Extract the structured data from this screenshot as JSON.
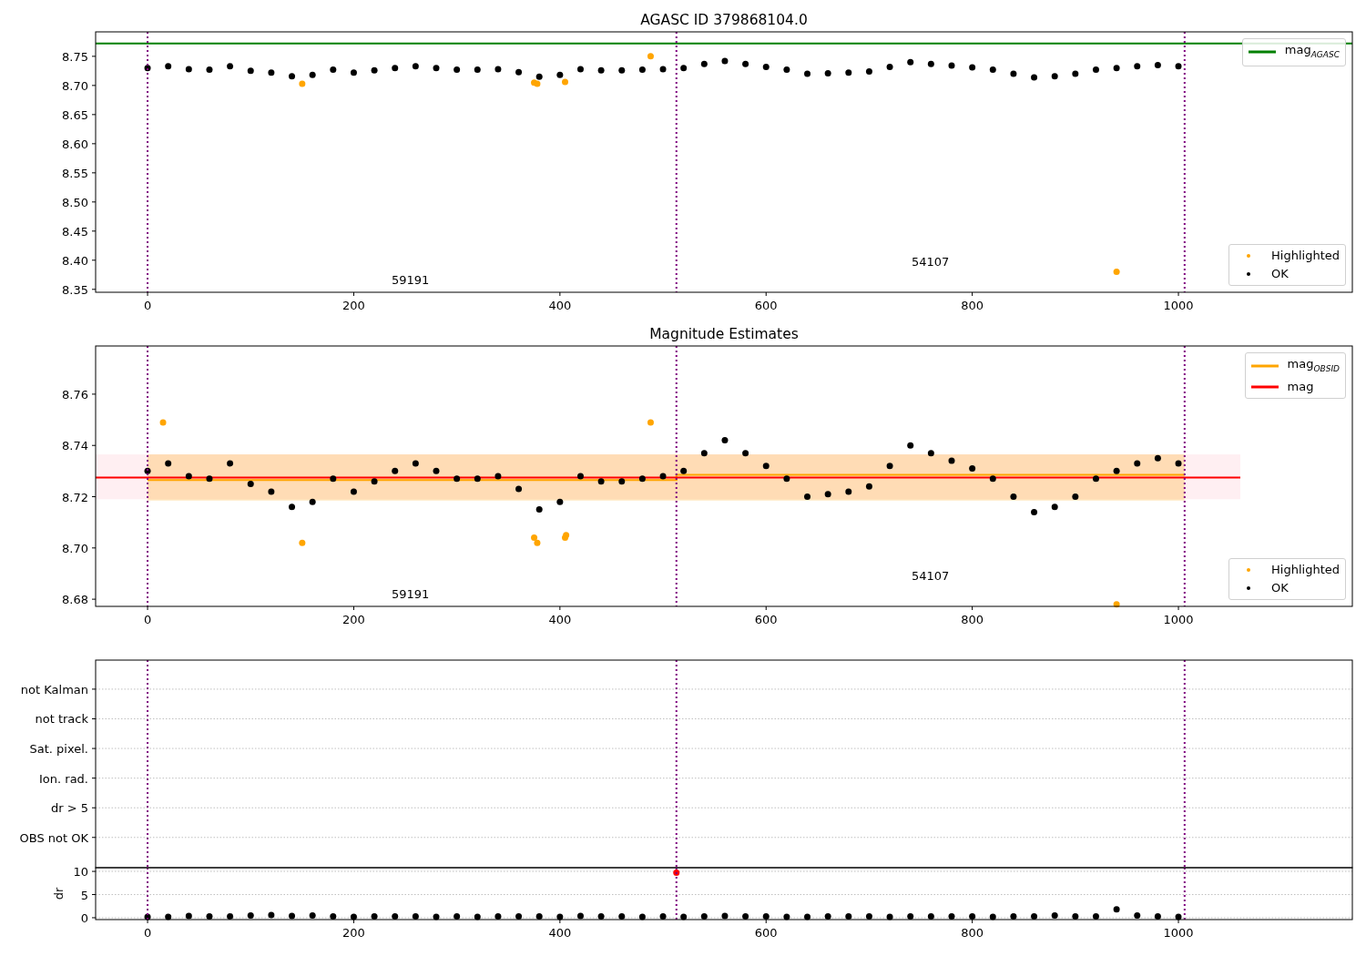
{
  "panels": [
    {
      "legend": true,
      "chart_data": {
        "type": "scatter",
        "title": "AGASC ID 379868104.0",
        "xlim": [
          -50.4,
          1168.7
        ],
        "ylim": [
          8.345,
          8.792
        ],
        "xticks": [
          0,
          200,
          400,
          600,
          800,
          1000
        ],
        "yticks": [
          {
            "value": 8.35,
            "label": "8.35"
          },
          {
            "value": 8.4,
            "label": "8.40"
          },
          {
            "value": 8.45,
            "label": "8.45"
          },
          {
            "value": 8.5,
            "label": "8.50"
          },
          {
            "value": 8.55,
            "label": "8.55"
          },
          {
            "value": 8.6,
            "label": "8.60"
          },
          {
            "value": 8.65,
            "label": "8.65"
          },
          {
            "value": 8.7,
            "label": "8.70"
          },
          {
            "value": 8.75,
            "label": "8.75"
          }
        ],
        "series": [
          {
            "name": "mag$_{AGASC}$",
            "type": "line",
            "color": "#008000",
            "x": [
              -50.4,
              1168.7
            ],
            "values": [
              8.772,
              8.772
            ]
          },
          {
            "name": "Highlighted",
            "color": "#ffa500",
            "x": [
              150,
              375,
              378,
              405,
              488,
              940
            ],
            "values": [
              8.703,
              8.705,
              8.703,
              8.706,
              8.75,
              8.38
            ]
          },
          {
            "name": "OK",
            "color": "#000000",
            "x": [
              0,
              20,
              40,
              60,
              80,
              100,
              120,
              140,
              160,
              180,
              200,
              220,
              240,
              260,
              280,
              300,
              320,
              340,
              360,
              380,
              400,
              420,
              440,
              460,
              480,
              500,
              520,
              540,
              560,
              580,
              600,
              620,
              640,
              660,
              680,
              700,
              720,
              740,
              760,
              780,
              800,
              820,
              840,
              860,
              880,
              900,
              920,
              940,
              960,
              980,
              1000
            ],
            "values": [
              8.73,
              8.733,
              8.728,
              8.727,
              8.733,
              8.725,
              8.722,
              8.716,
              8.718,
              8.727,
              8.722,
              8.726,
              8.73,
              8.733,
              8.73,
              8.727,
              8.727,
              8.728,
              8.723,
              8.715,
              8.718,
              8.728,
              8.726,
              8.726,
              8.727,
              8.728,
              8.73,
              8.737,
              8.742,
              8.737,
              8.732,
              8.727,
              8.72,
              8.721,
              8.722,
              8.724,
              8.732,
              8.74,
              8.737,
              8.734,
              8.731,
              8.727,
              8.72,
              8.714,
              8.716,
              8.72,
              8.727,
              8.73,
              8.733,
              8.735,
              8.733
            ]
          }
        ],
        "ref_lines": [
          {
            "axis": "x",
            "value": 0,
            "color": "#800080"
          },
          {
            "axis": "x",
            "value": 513,
            "color": "#800080"
          },
          {
            "axis": "x",
            "value": 1006,
            "color": "#800080"
          }
        ],
        "annotations": [
          "59191",
          "54107"
        ]
      }
    },
    {
      "legend": true,
      "chart_data": {
        "type": "scatter",
        "title": "Magnitude Estimates",
        "xlim": [
          -50.4,
          1168.7
        ],
        "ylim": [
          8.6772,
          8.7788
        ],
        "xticks": [
          0,
          200,
          400,
          600,
          800,
          1000
        ],
        "yticks": [
          {
            "value": 8.68,
            "label": "8.68"
          },
          {
            "value": 8.7,
            "label": "8.70"
          },
          {
            "value": 8.72,
            "label": "8.72"
          },
          {
            "value": 8.74,
            "label": "8.74"
          },
          {
            "value": 8.76,
            "label": "8.76"
          }
        ],
        "series": [
          {
            "name": "mag$_{OBSID}$",
            "type": "line",
            "color": "#ffa500",
            "x": [
              0,
              513,
              513,
              1006
            ],
            "values": [
              8.7265,
              8.7265,
              8.7285,
              8.7285
            ]
          },
          {
            "name": "mag",
            "type": "line",
            "color": "#ff0000",
            "x": [
              -50.4,
              1060
            ],
            "values": [
              8.7275,
              8.7275
            ]
          },
          {
            "name": "Highlighted",
            "color": "#ffa500",
            "x": [
              15,
              150,
              375,
              378,
              405,
              406,
              488,
              940
            ],
            "values": [
              8.749,
              8.702,
              8.704,
              8.702,
              8.704,
              8.705,
              8.749,
              8.678
            ]
          },
          {
            "name": "OK",
            "color": "#000000",
            "x": [
              0,
              20,
              40,
              60,
              80,
              100,
              120,
              140,
              160,
              180,
              200,
              220,
              240,
              260,
              280,
              300,
              320,
              340,
              360,
              380,
              400,
              420,
              440,
              460,
              480,
              500,
              520,
              540,
              560,
              580,
              600,
              620,
              640,
              660,
              680,
              700,
              720,
              740,
              760,
              780,
              800,
              820,
              840,
              860,
              880,
              900,
              920,
              940,
              960,
              980,
              1000
            ],
            "values": [
              8.73,
              8.733,
              8.728,
              8.727,
              8.733,
              8.725,
              8.722,
              8.716,
              8.718,
              8.727,
              8.722,
              8.726,
              8.73,
              8.733,
              8.73,
              8.727,
              8.727,
              8.728,
              8.723,
              8.715,
              8.718,
              8.728,
              8.726,
              8.726,
              8.727,
              8.728,
              8.73,
              8.737,
              8.742,
              8.737,
              8.732,
              8.727,
              8.72,
              8.721,
              8.722,
              8.724,
              8.732,
              8.74,
              8.737,
              8.734,
              8.731,
              8.727,
              8.72,
              8.714,
              8.716,
              8.72,
              8.727,
              8.73,
              8.733,
              8.735,
              8.733
            ]
          }
        ],
        "bands": [
          {
            "axis": "y",
            "from": 8.719,
            "to": 8.7365,
            "color": "#ffc0cb"
          },
          {
            "axis": "y",
            "from": 8.7185,
            "to": 8.7365,
            "color": "#ffa500"
          }
        ],
        "ref_lines": [
          {
            "axis": "x",
            "value": 0,
            "color": "#800080"
          },
          {
            "axis": "x",
            "value": 513,
            "color": "#800080"
          },
          {
            "axis": "x",
            "value": 1006,
            "color": "#800080"
          }
        ],
        "annotations": [
          "59191",
          "54107"
        ]
      }
    },
    {
      "chart_data": {
        "type": "other",
        "categories": [
          "not Kalman",
          "not track",
          "Sat. pixel.",
          "Ion. rad.",
          "dr > 5",
          "OBS not OK"
        ]
      }
    },
    {
      "chart_data": {
        "type": "scatter",
        "ylabel": "dr",
        "xlim": [
          -50.4,
          1168.7
        ],
        "ylim": [
          -0.4,
          10.8
        ],
        "xticks": [
          0,
          200,
          400,
          600,
          800,
          1000
        ],
        "yticks": [
          0,
          5,
          10
        ],
        "series": [
          {
            "color": "#000000",
            "x": [
              0,
              20,
              40,
              60,
              80,
              100,
              120,
              140,
              160,
              180,
              200,
              220,
              240,
              260,
              280,
              300,
              320,
              340,
              360,
              380,
              400,
              420,
              440,
              460,
              480,
              500,
              520,
              540,
              560,
              580,
              600,
              620,
              640,
              660,
              680,
              700,
              720,
              740,
              760,
              780,
              800,
              820,
              840,
              860,
              880,
              900,
              920,
              940,
              960,
              980,
              1000
            ],
            "values": [
              0.2,
              0.2,
              0.4,
              0.3,
              0.3,
              0.5,
              0.6,
              0.4,
              0.5,
              0.3,
              0.2,
              0.3,
              0.3,
              0.3,
              0.2,
              0.3,
              0.2,
              0.3,
              0.3,
              0.3,
              0.2,
              0.4,
              0.3,
              0.3,
              0.2,
              0.3,
              0.2,
              0.3,
              0.4,
              0.3,
              0.3,
              0.2,
              0.2,
              0.3,
              0.3,
              0.3,
              0.2,
              0.3,
              0.3,
              0.3,
              0.3,
              0.2,
              0.3,
              0.3,
              0.5,
              0.3,
              0.3,
              1.8,
              0.5,
              0.3,
              0.2
            ]
          },
          {
            "color": "#ff0000",
            "x": [
              513
            ],
            "values": [
              9.7
            ]
          }
        ],
        "ref_lines": [
          {
            "axis": "x",
            "value": 0,
            "color": "#800080"
          },
          {
            "axis": "x",
            "value": 513,
            "color": "#800080"
          },
          {
            "axis": "x",
            "value": 1006,
            "color": "#800080"
          }
        ]
      }
    }
  ]
}
